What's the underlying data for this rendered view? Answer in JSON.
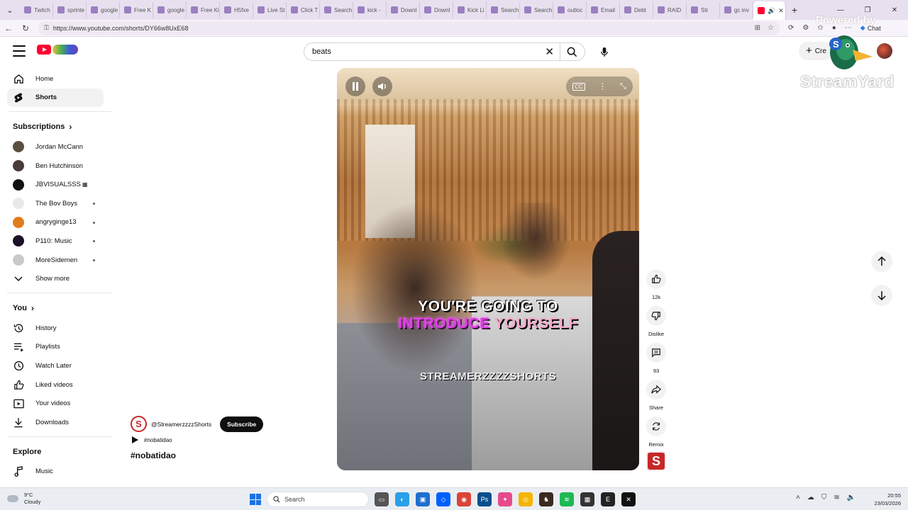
{
  "browser": {
    "tabs": [
      {
        "label": "Twitch"
      },
      {
        "label": "sprinte"
      },
      {
        "label": "google"
      },
      {
        "label": "Free K"
      },
      {
        "label": "google"
      },
      {
        "label": "Free Ki"
      },
      {
        "label": "H5fxe"
      },
      {
        "label": "Live St"
      },
      {
        "label": "Click T"
      },
      {
        "label": "Search"
      },
      {
        "label": "kick -"
      },
      {
        "label": "Downl"
      },
      {
        "label": "Downl"
      },
      {
        "label": "Kick Li"
      },
      {
        "label": "Search"
      },
      {
        "label": "Search"
      },
      {
        "label": "outloc"
      },
      {
        "label": "Email"
      },
      {
        "label": "Debt"
      },
      {
        "label": "RAID"
      },
      {
        "label": "Str"
      },
      {
        "label": "gc inv"
      }
    ],
    "active_tab_close": "✕",
    "new_tab": "+",
    "url": "https://www.youtube.com/shorts/DY66w8UxE68",
    "chat_label": "Chat"
  },
  "header": {
    "search_value": "beats",
    "create_label": "Cre"
  },
  "overlay": {
    "powered_by": "Powered by",
    "brand": "StreamYard"
  },
  "sidebar": {
    "main": [
      {
        "label": "Home",
        "icon": "home-icon"
      },
      {
        "label": "Shorts",
        "icon": "shorts-icon"
      }
    ],
    "subscriptions_title": "Subscriptions",
    "subscriptions": [
      {
        "label": "Jordan McCann",
        "color": "#5a5040",
        "live": false
      },
      {
        "label": "Ben Hutchinson",
        "color": "#4a3a3a",
        "live": false
      },
      {
        "label": "JBVISUALSSS",
        "color": "#111111",
        "live": false,
        "badge": "▦"
      },
      {
        "label": "The Bov Boys",
        "color": "#e8e8e8",
        "live": true
      },
      {
        "label": "angryginge13",
        "color": "#e07b1e",
        "live": true
      },
      {
        "label": "P110: Music",
        "color": "#1a1028",
        "live": true
      },
      {
        "label": "MoreSidemen",
        "color": "#c9c9c9",
        "live": true
      }
    ],
    "show_more": "Show more",
    "you_title": "You",
    "you_items": [
      {
        "label": "History",
        "icon": "history-icon"
      },
      {
        "label": "Playlists",
        "icon": "playlists-icon"
      },
      {
        "label": "Watch Later",
        "icon": "watch-later-icon"
      },
      {
        "label": "Liked videos",
        "icon": "liked-videos-icon"
      },
      {
        "label": "Your videos",
        "icon": "your-videos-icon"
      },
      {
        "label": "Downloads",
        "icon": "downloads-icon"
      }
    ],
    "explore_title": "Explore",
    "explore_items": [
      {
        "label": "Music",
        "icon": "music-icon"
      }
    ]
  },
  "video": {
    "caption_line1": "YOU'RE GOING TO",
    "caption_line2_highlight": "INTRODUCE",
    "caption_line2_rest": "YOURSELF",
    "watermark": "STREAMERZZZZSHORTS"
  },
  "actions": {
    "like_count": "12k",
    "dislike_label": "Dislike",
    "comment_count": "93",
    "share_label": "Share",
    "remix_label": "Remix"
  },
  "channel": {
    "handle": "@StreamerzzzzShorts",
    "avatar_letter": "S",
    "subscribe_label": "Subscribe",
    "sound_label": "#nobatidao",
    "title": "#nobatidao"
  },
  "taskbar": {
    "temperature": "9°C",
    "weather": "Cloudy",
    "search_label": "Search",
    "time": "20:55",
    "date": "23/03/2026"
  }
}
